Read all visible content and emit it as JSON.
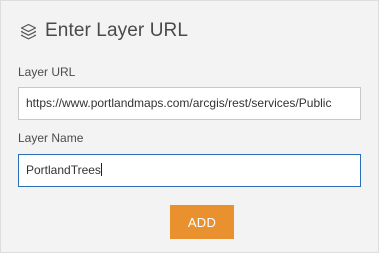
{
  "dialog": {
    "title": "Enter Layer URL",
    "icon": "layers-icon"
  },
  "form": {
    "layer_url_label": "Layer URL",
    "layer_url_value": "https://www.portlandmaps.com/arcgis/rest/services/Public",
    "layer_name_label": "Layer Name",
    "layer_name_value": "PortlandTrees"
  },
  "actions": {
    "add_label": "ADD"
  },
  "colors": {
    "panel_background": "#f3f3f3",
    "add_button": "#e8912e",
    "focused_border": "#2a6fb5"
  }
}
